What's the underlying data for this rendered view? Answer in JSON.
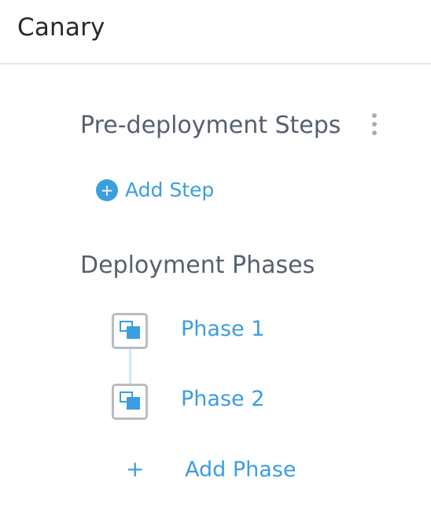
{
  "header": {
    "title": "Canary"
  },
  "pre_deployment": {
    "title": "Pre-deployment Steps",
    "more_icon": "vertical-ellipsis",
    "add_step_label": "Add Step",
    "add_step_icon": "plus-circle"
  },
  "deployment_phases": {
    "title": "Deployment Phases",
    "phases": [
      {
        "label": "Phase 1",
        "icon": "phase-stack"
      },
      {
        "label": "Phase 2",
        "icon": "phase-stack"
      }
    ],
    "add_phase_symbol": "+",
    "add_phase_label": "Add Phase"
  },
  "colors": {
    "accent": "#3b9ee0",
    "heading": "#56606f",
    "title": "#26292e",
    "icon_border": "#b9bcc1",
    "connector": "#d2e6f6"
  }
}
